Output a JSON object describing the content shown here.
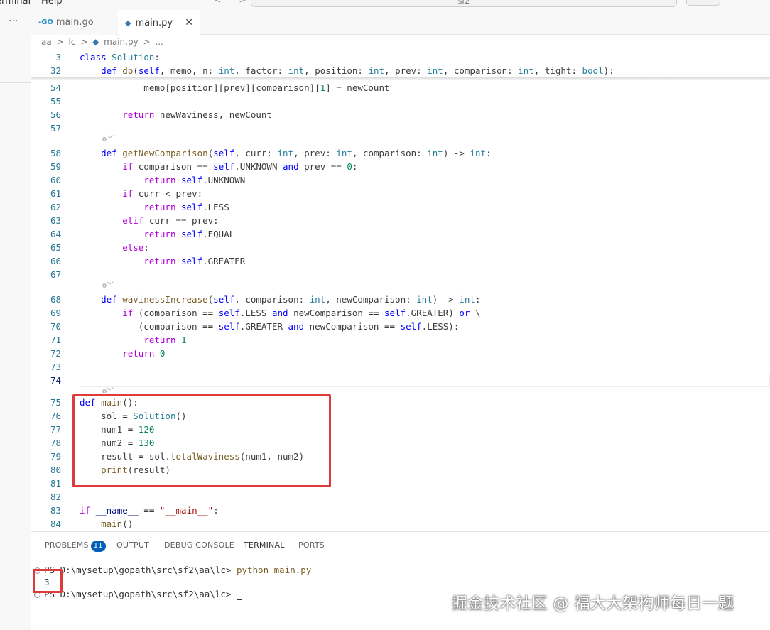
{
  "menu": {
    "terminal": "erminal",
    "help": "Help"
  },
  "command_center": {
    "label": "sf2"
  },
  "tabs": [
    {
      "label": "main.go",
      "icon": "go-icon",
      "active": false
    },
    {
      "label": "main.py",
      "icon": "python-icon",
      "active": true
    }
  ],
  "breadcrumb": [
    "aa",
    ">",
    "lc",
    ">",
    "main.py",
    ">",
    "..."
  ],
  "editor": {
    "sticky": [
      {
        "num": "3",
        "code": "class Solution:"
      },
      {
        "num": "32",
        "code": "    def dp(self, memo, n: int, factor: int, position: int, prev: int, comparison: int, tight: bool):"
      }
    ],
    "lines": [
      {
        "num": "54",
        "code": "            memo[position][prev][comparison][1] = newCount"
      },
      {
        "num": "55",
        "code": ""
      },
      {
        "num": "56",
        "code": "        return newWaviness, newCount"
      },
      {
        "num": "57",
        "code": ""
      },
      {
        "num": "58",
        "code": "    def getNewComparison(self, curr: int, prev: int, comparison: int) -> int:"
      },
      {
        "num": "59",
        "code": "        if comparison == self.UNKNOWN and prev == 0:"
      },
      {
        "num": "60",
        "code": "            return self.UNKNOWN"
      },
      {
        "num": "61",
        "code": "        if curr < prev:"
      },
      {
        "num": "62",
        "code": "            return self.LESS"
      },
      {
        "num": "63",
        "code": "        elif curr == prev:"
      },
      {
        "num": "64",
        "code": "            return self.EQUAL"
      },
      {
        "num": "65",
        "code": "        else:"
      },
      {
        "num": "66",
        "code": "            return self.GREATER"
      },
      {
        "num": "67",
        "code": ""
      },
      {
        "num": "68",
        "code": "    def wavinessIncrease(self, comparison: int, newComparison: int) -> int:"
      },
      {
        "num": "69",
        "code": "        if (comparison == self.LESS and newComparison == self.GREATER) or \\"
      },
      {
        "num": "70",
        "code": "           (comparison == self.GREATER and newComparison == self.LESS):"
      },
      {
        "num": "71",
        "code": "            return 1"
      },
      {
        "num": "72",
        "code": "        return 0"
      },
      {
        "num": "73",
        "code": ""
      },
      {
        "num": "74",
        "code": ""
      },
      {
        "num": "75",
        "code": "def main():"
      },
      {
        "num": "76",
        "code": "    sol = Solution()"
      },
      {
        "num": "77",
        "code": "    num1 = 120"
      },
      {
        "num": "78",
        "code": "    num2 = 130"
      },
      {
        "num": "79",
        "code": "    result = sol.totalWaviness(num1, num2)"
      },
      {
        "num": "80",
        "code": "    print(result)"
      },
      {
        "num": "81",
        "code": ""
      },
      {
        "num": "82",
        "code": ""
      },
      {
        "num": "83",
        "code": "if __name__ == \"__main__\":"
      },
      {
        "num": "84",
        "code": "    main()"
      }
    ]
  },
  "panel": {
    "tabs": [
      {
        "label": "PROBLEMS",
        "badge": "11"
      },
      {
        "label": "OUTPUT"
      },
      {
        "label": "DEBUG CONSOLE"
      },
      {
        "label": "TERMINAL",
        "active": true
      },
      {
        "label": "PORTS"
      }
    ],
    "terminal": {
      "line1_prompt": "PS D:\\mysetup\\gopath\\src\\sf2\\aa\\lc> ",
      "line1_cmd": "python main.py",
      "line2_output": "3",
      "line3_prompt": "PS D:\\mysetup\\gopath\\src\\sf2\\aa\\lc> "
    }
  },
  "watermark": "掘金技术社区 @ 福大大架构师每日一题",
  "colors": {
    "highlight_border": "#e03b3b",
    "badge_bg": "#005fb8",
    "line_number": "#237893"
  }
}
